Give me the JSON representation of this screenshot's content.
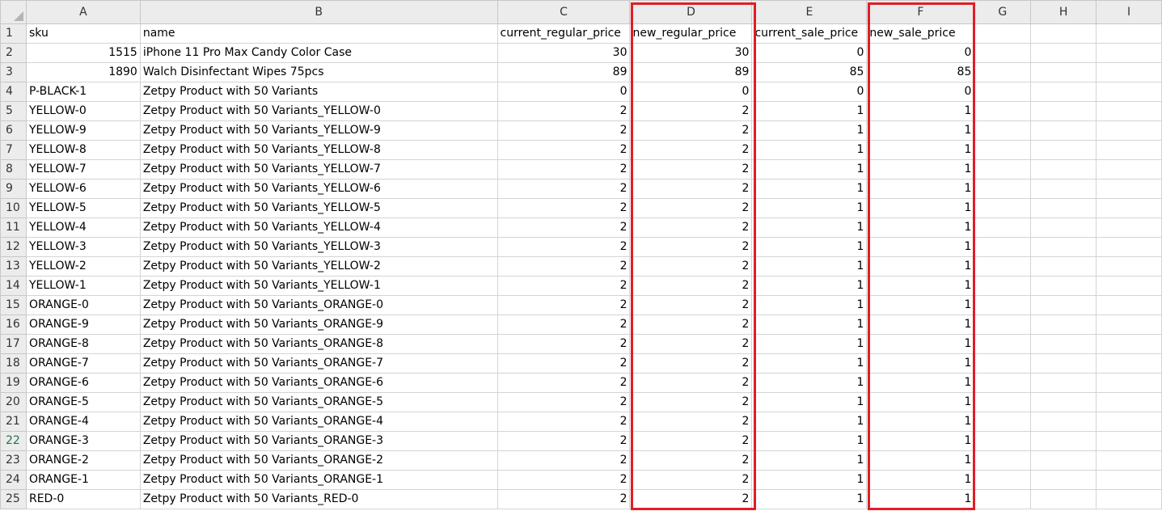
{
  "columns": [
    "A",
    "B",
    "C",
    "D",
    "E",
    "F",
    "G",
    "H",
    "I"
  ],
  "highlight_color": "#e01e27",
  "highlighted_columns": [
    "D",
    "F"
  ],
  "rows": [
    {
      "n": "1",
      "a": "sku",
      "b": "name",
      "c": "current_regular_price",
      "d": "new_regular_price",
      "e": "current_sale_price",
      "f": "new_sale_price"
    },
    {
      "n": "2",
      "a": "1515",
      "b": "iPhone 11 Pro Max Candy Color Case",
      "c": "30",
      "d": "30",
      "e": "0",
      "f": "0"
    },
    {
      "n": "3",
      "a": "1890",
      "b": "Walch Disinfectant Wipes 75pcs",
      "c": "89",
      "d": "89",
      "e": "85",
      "f": "85"
    },
    {
      "n": "4",
      "a": "P-BLACK-1",
      "b": "Zetpy Product with 50 Variants",
      "c": "0",
      "d": "0",
      "e": "0",
      "f": "0"
    },
    {
      "n": "5",
      "a": "YELLOW-0",
      "b": "Zetpy Product with 50 Variants_YELLOW-0",
      "c": "2",
      "d": "2",
      "e": "1",
      "f": "1"
    },
    {
      "n": "6",
      "a": "YELLOW-9",
      "b": "Zetpy Product with 50 Variants_YELLOW-9",
      "c": "2",
      "d": "2",
      "e": "1",
      "f": "1"
    },
    {
      "n": "7",
      "a": "YELLOW-8",
      "b": "Zetpy Product with 50 Variants_YELLOW-8",
      "c": "2",
      "d": "2",
      "e": "1",
      "f": "1"
    },
    {
      "n": "8",
      "a": "YELLOW-7",
      "b": "Zetpy Product with 50 Variants_YELLOW-7",
      "c": "2",
      "d": "2",
      "e": "1",
      "f": "1"
    },
    {
      "n": "9",
      "a": "YELLOW-6",
      "b": "Zetpy Product with 50 Variants_YELLOW-6",
      "c": "2",
      "d": "2",
      "e": "1",
      "f": "1"
    },
    {
      "n": "10",
      "a": "YELLOW-5",
      "b": "Zetpy Product with 50 Variants_YELLOW-5",
      "c": "2",
      "d": "2",
      "e": "1",
      "f": "1"
    },
    {
      "n": "11",
      "a": "YELLOW-4",
      "b": "Zetpy Product with 50 Variants_YELLOW-4",
      "c": "2",
      "d": "2",
      "e": "1",
      "f": "1"
    },
    {
      "n": "12",
      "a": "YELLOW-3",
      "b": "Zetpy Product with 50 Variants_YELLOW-3",
      "c": "2",
      "d": "2",
      "e": "1",
      "f": "1"
    },
    {
      "n": "13",
      "a": "YELLOW-2",
      "b": "Zetpy Product with 50 Variants_YELLOW-2",
      "c": "2",
      "d": "2",
      "e": "1",
      "f": "1"
    },
    {
      "n": "14",
      "a": "YELLOW-1",
      "b": "Zetpy Product with 50 Variants_YELLOW-1",
      "c": "2",
      "d": "2",
      "e": "1",
      "f": "1"
    },
    {
      "n": "15",
      "a": "ORANGE-0",
      "b": "Zetpy Product with 50 Variants_ORANGE-0",
      "c": "2",
      "d": "2",
      "e": "1",
      "f": "1"
    },
    {
      "n": "16",
      "a": "ORANGE-9",
      "b": "Zetpy Product with 50 Variants_ORANGE-9",
      "c": "2",
      "d": "2",
      "e": "1",
      "f": "1"
    },
    {
      "n": "17",
      "a": "ORANGE-8",
      "b": "Zetpy Product with 50 Variants_ORANGE-8",
      "c": "2",
      "d": "2",
      "e": "1",
      "f": "1"
    },
    {
      "n": "18",
      "a": "ORANGE-7",
      "b": "Zetpy Product with 50 Variants_ORANGE-7",
      "c": "2",
      "d": "2",
      "e": "1",
      "f": "1"
    },
    {
      "n": "19",
      "a": "ORANGE-6",
      "b": "Zetpy Product with 50 Variants_ORANGE-6",
      "c": "2",
      "d": "2",
      "e": "1",
      "f": "1"
    },
    {
      "n": "20",
      "a": "ORANGE-5",
      "b": "Zetpy Product with 50 Variants_ORANGE-5",
      "c": "2",
      "d": "2",
      "e": "1",
      "f": "1"
    },
    {
      "n": "21",
      "a": "ORANGE-4",
      "b": "Zetpy Product with 50 Variants_ORANGE-4",
      "c": "2",
      "d": "2",
      "e": "1",
      "f": "1"
    },
    {
      "n": "22",
      "a": "ORANGE-3",
      "b": "Zetpy Product with 50 Variants_ORANGE-3",
      "c": "2",
      "d": "2",
      "e": "1",
      "f": "1"
    },
    {
      "n": "23",
      "a": "ORANGE-2",
      "b": "Zetpy Product with 50 Variants_ORANGE-2",
      "c": "2",
      "d": "2",
      "e": "1",
      "f": "1"
    },
    {
      "n": "24",
      "a": "ORANGE-1",
      "b": "Zetpy Product with 50 Variants_ORANGE-1",
      "c": "2",
      "d": "2",
      "e": "1",
      "f": "1"
    },
    {
      "n": "25",
      "a": "RED-0",
      "b": "Zetpy Product with 50 Variants_RED-0",
      "c": "2",
      "d": "2",
      "e": "1",
      "f": "1"
    }
  ]
}
